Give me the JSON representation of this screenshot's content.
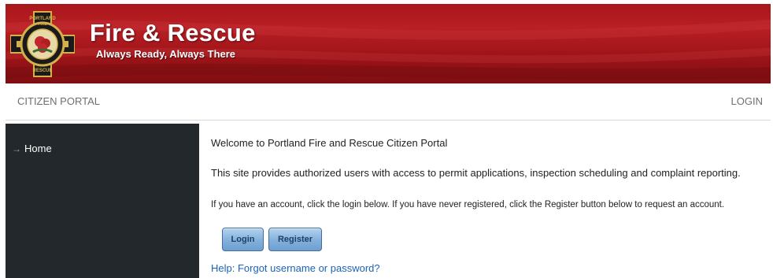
{
  "header": {
    "title": "Fire & Rescue",
    "tagline": "Always Ready, Always There",
    "badge": {
      "icon": "fire-department-badge-icon",
      "top_text": "PORTLAND",
      "top_text_2": "FIRE",
      "bottom_text": "RESCUE",
      "colors": {
        "ring": "#1a1a1a",
        "gold": "#d4b04a",
        "rose": "#c0282d"
      }
    }
  },
  "topbar": {
    "portal_title": "CITIZEN PORTAL",
    "login_link": "LOGIN"
  },
  "sidebar": {
    "items": [
      {
        "label": "Home",
        "icon": "arrow-right-icon"
      }
    ]
  },
  "main": {
    "welcome": "Welcome to Portland Fire and Rescue Citizen Portal",
    "description": "This site provides authorized users with access to permit applications, inspection scheduling and complaint reporting.",
    "instructions": "If you have an account, click the login below. If you have never registered, click the Register button below to request an account.",
    "login_button": "Login",
    "register_button": "Register",
    "help_link": "Help: Forgot username or password?"
  },
  "colors": {
    "banner_red": "#a8161b",
    "sidebar_bg": "#22282c",
    "button_blue": "#82b0db",
    "link_blue": "#1a63b7"
  }
}
